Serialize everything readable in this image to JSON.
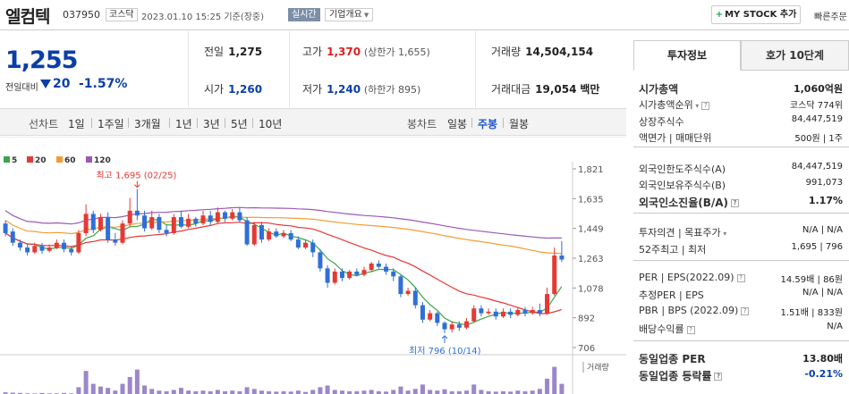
{
  "header": {
    "name": "엘컴텍",
    "code": "037950",
    "market": "코스닥",
    "datetime": "2023.01.10 15:25 기준(장중)",
    "live": "실시간",
    "corp_info": "기업개요",
    "mystock": "MY STOCK 추가",
    "quick": "빠른주문"
  },
  "price": {
    "now": "1,255",
    "vs_label": "전일대비",
    "change": "20",
    "pct": "-1.57%"
  },
  "summary": {
    "prev_label": "전일",
    "prev": "1,275",
    "high_label": "고가",
    "high": "1,370",
    "high_limit": "(상한가 1,655)",
    "vol_label": "거래량",
    "vol": "14,504,154",
    "open_label": "시가",
    "open": "1,260",
    "low_label": "저가",
    "low": "1,240",
    "low_limit": "(하한가 895)",
    "amt_label": "거래대금",
    "amt": "19,054",
    "amt_unit": "백만"
  },
  "tabs": {
    "line_label": "선차트",
    "line": [
      "1일",
      "1주일",
      "3개월",
      "1년",
      "3년",
      "5년",
      "10년"
    ],
    "candle_label": "봉차트",
    "candle": [
      "일봉",
      "주봉",
      "월봉"
    ],
    "active": "주봉"
  },
  "chart_data": {
    "type": "candlestick",
    "legend": [
      {
        "name": "5",
        "color": "#3aa64a"
      },
      {
        "name": "20",
        "color": "#e53935"
      },
      {
        "name": "60",
        "color": "#f39c34"
      },
      {
        "name": "120",
        "color": "#9b59b6"
      }
    ],
    "y_ticks": [
      "1,821",
      "1,635",
      "1,449",
      "1,263",
      "1,078",
      "892",
      "706"
    ],
    "ylim": [
      706,
      1821
    ],
    "high_annotation": "최고 1,695 (02/25)",
    "low_annotation": "최저 796 (10/14)",
    "volume_label": "거래량",
    "up_color": "#e53935",
    "down_color": "#2f6fd6",
    "candles": [
      [
        1480,
        1420,
        1500,
        1400
      ],
      [
        1430,
        1360,
        1450,
        1340
      ],
      [
        1360,
        1330,
        1380,
        1310
      ],
      [
        1330,
        1300,
        1350,
        1280
      ],
      [
        1300,
        1340,
        1360,
        1290
      ],
      [
        1340,
        1310,
        1360,
        1290
      ],
      [
        1310,
        1330,
        1350,
        1300
      ],
      [
        1330,
        1360,
        1380,
        1320
      ],
      [
        1360,
        1320,
        1380,
        1300
      ],
      [
        1320,
        1300,
        1340,
        1280
      ],
      [
        1300,
        1420,
        1440,
        1290
      ],
      [
        1420,
        1540,
        1600,
        1400
      ],
      [
        1540,
        1440,
        1560,
        1420
      ],
      [
        1440,
        1520,
        1540,
        1430
      ],
      [
        1520,
        1380,
        1550,
        1360
      ],
      [
        1380,
        1360,
        1420,
        1340
      ],
      [
        1360,
        1480,
        1500,
        1350
      ],
      [
        1480,
        1560,
        1640,
        1460
      ],
      [
        1560,
        1530,
        1695,
        1500
      ],
      [
        1530,
        1450,
        1560,
        1430
      ],
      [
        1450,
        1520,
        1560,
        1440
      ],
      [
        1520,
        1440,
        1540,
        1420
      ],
      [
        1440,
        1420,
        1470,
        1400
      ],
      [
        1420,
        1520,
        1540,
        1410
      ],
      [
        1520,
        1460,
        1560,
        1450
      ],
      [
        1460,
        1510,
        1540,
        1450
      ],
      [
        1510,
        1480,
        1520,
        1460
      ],
      [
        1480,
        1530,
        1560,
        1470
      ],
      [
        1530,
        1490,
        1560,
        1470
      ],
      [
        1490,
        1550,
        1580,
        1480
      ],
      [
        1550,
        1510,
        1560,
        1490
      ],
      [
        1510,
        1550,
        1570,
        1500
      ],
      [
        1550,
        1500,
        1580,
        1490
      ],
      [
        1500,
        1350,
        1520,
        1340
      ],
      [
        1350,
        1470,
        1490,
        1340
      ],
      [
        1470,
        1380,
        1490,
        1360
      ],
      [
        1380,
        1430,
        1450,
        1370
      ],
      [
        1430,
        1400,
        1450,
        1390
      ],
      [
        1400,
        1420,
        1440,
        1390
      ],
      [
        1420,
        1380,
        1440,
        1370
      ],
      [
        1380,
        1330,
        1400,
        1320
      ],
      [
        1330,
        1360,
        1380,
        1320
      ],
      [
        1360,
        1300,
        1380,
        1270
      ],
      [
        1300,
        1200,
        1320,
        1180
      ],
      [
        1200,
        1110,
        1220,
        1080
      ],
      [
        1110,
        1180,
        1200,
        1100
      ],
      [
        1180,
        1140,
        1200,
        1120
      ],
      [
        1140,
        1180,
        1190,
        1130
      ],
      [
        1180,
        1160,
        1200,
        1150
      ],
      [
        1160,
        1190,
        1210,
        1150
      ],
      [
        1190,
        1230,
        1240,
        1180
      ],
      [
        1230,
        1210,
        1250,
        1200
      ],
      [
        1210,
        1180,
        1230,
        1160
      ],
      [
        1180,
        1150,
        1200,
        1120
      ],
      [
        1150,
        1040,
        1160,
        1020
      ],
      [
        1040,
        1060,
        1080,
        1030
      ],
      [
        1060,
        970,
        1080,
        950
      ],
      [
        970,
        880,
        990,
        860
      ],
      [
        880,
        920,
        940,
        870
      ],
      [
        920,
        860,
        930,
        840
      ],
      [
        860,
        820,
        870,
        796
      ],
      [
        820,
        850,
        870,
        800
      ],
      [
        850,
        830,
        870,
        810
      ],
      [
        830,
        870,
        890,
        820
      ],
      [
        870,
        950,
        970,
        860
      ],
      [
        950,
        920,
        970,
        900
      ],
      [
        920,
        930,
        950,
        910
      ],
      [
        930,
        900,
        950,
        880
      ],
      [
        900,
        930,
        950,
        890
      ],
      [
        930,
        910,
        950,
        890
      ],
      [
        910,
        940,
        960,
        900
      ],
      [
        940,
        920,
        960,
        900
      ],
      [
        920,
        940,
        960,
        910
      ],
      [
        940,
        920,
        980,
        900
      ],
      [
        920,
        1040,
        1080,
        910
      ],
      [
        1040,
        1280,
        1330,
        1030
      ],
      [
        1280,
        1255,
        1370,
        1240
      ]
    ],
    "volumes": [
      0.05,
      0.04,
      0.03,
      0.02,
      0.02,
      0.03,
      0.02,
      0.02,
      0.03,
      0.02,
      0.2,
      0.68,
      0.3,
      0.22,
      0.18,
      0.1,
      0.3,
      0.5,
      0.72,
      0.25,
      0.15,
      0.1,
      0.08,
      0.12,
      0.18,
      0.1,
      0.08,
      0.1,
      0.08,
      0.12,
      0.08,
      0.1,
      0.08,
      0.2,
      0.15,
      0.1,
      0.08,
      0.07,
      0.08,
      0.07,
      0.1,
      0.06,
      0.12,
      0.2,
      0.25,
      0.12,
      0.1,
      0.08,
      0.08,
      0.1,
      0.12,
      0.08,
      0.07,
      0.12,
      0.22,
      0.1,
      0.15,
      0.28,
      0.12,
      0.1,
      0.14,
      0.08,
      0.08,
      0.1,
      0.28,
      0.12,
      0.08,
      0.07,
      0.08,
      0.07,
      0.1,
      0.08,
      0.1,
      0.15,
      0.45,
      0.8,
      0.3
    ]
  },
  "invest": {
    "tab_on": "투자정보",
    "tab_off": "호가 10단계",
    "rows": [
      {
        "k": "시가총액",
        "v": "1,060억원",
        "bold": true
      },
      {
        "k": "시가총액순위",
        "v": "코스닥 774위"
      },
      {
        "k": "상장주식수",
        "v": "84,447,519"
      },
      {
        "k": "액면가 | 매매단위",
        "v": "500원 | 1주"
      },
      {
        "k": "외국인한도주식수(A)",
        "v": "84,447,519"
      },
      {
        "k": "외국인보유주식수(B)",
        "v": "991,073"
      },
      {
        "k": "외국인소진율(B/A)",
        "v": "1.17%",
        "bold": true
      },
      {
        "k": "투자의견 | 목표주가",
        "v": "N/A | N/A"
      },
      {
        "k": "52주최고 | 최저",
        "v": "1,695 | 796"
      },
      {
        "k": "PER | EPS(2022.09)",
        "v": "14.59배 | 86원"
      },
      {
        "k": "추정PER | EPS",
        "v": "N/A | N/A"
      },
      {
        "k": "PBR | BPS (2022.09)",
        "v": "1.51배 | 833원"
      },
      {
        "k": "배당수익률",
        "v": "N/A"
      },
      {
        "k": "동일업종 PER",
        "v": "13.80배",
        "bold": true
      },
      {
        "k": "동일업종 등락률",
        "v": "-0.21%",
        "bold": true
      }
    ]
  }
}
